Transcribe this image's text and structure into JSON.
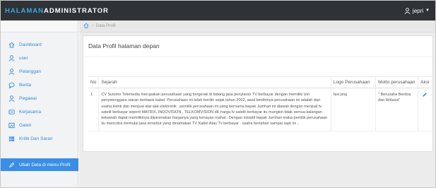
{
  "header": {
    "brand_part1": "HALAMAN",
    "brand_part2": "ADMINISTRATOR",
    "user_name": "jepri",
    "user_icon": "user-icon",
    "caret_icon": "caret-down-icon"
  },
  "breadcrumb": {
    "home_icon": "home-icon",
    "current": "Data Profil"
  },
  "sidebar": {
    "items": [
      {
        "label": "Dashboard",
        "icon": "home-icon"
      },
      {
        "label": "user",
        "icon": "user-icon"
      },
      {
        "label": "Pelanggan",
        "icon": "user-icon"
      },
      {
        "label": "Berita",
        "icon": "comment-icon"
      },
      {
        "label": "Pegawai",
        "icon": "user-icon"
      },
      {
        "label": "Kerjasama",
        "icon": "handshake-icon"
      },
      {
        "label": "Galeri",
        "icon": "image-icon"
      },
      {
        "label": "Kritik Dan Saran",
        "icon": "table-icon"
      }
    ],
    "active_item": {
      "label": "Ubah Data di menu Profil",
      "icon": "pencil-icon"
    }
  },
  "panel": {
    "title": "Data Profil halaman depan"
  },
  "table": {
    "headers": [
      "No",
      "Sejarah",
      "Logo Perusahaan",
      "Motto perusahaan",
      "Aksi"
    ],
    "rows": [
      {
        "no": "1",
        "sejarah": "CV Sutomo Telemedia merupakan perusahaan yang bergerak di bidang jasa penyiaran TV berbayar dengan memiliki izin penyelenggara siaran berbasis kabel. Perusahaan ini telah berdiri sejak tahun 2002, awal berdirinya perusahaan ini adalah dari usaha listrik dan menjual alat alat elektronik . pemilik perusahaan ini yang bernama bapak Jumhari ini diawali dengan menjual tv satelit berbayar seperti MATRIX, INDOVISION , TELKOMVISION dll. harga tv satelit berbayar itu mungkin tidak semua kalangan kebawah dapat memilikinya dikarenakan harganya yang lumayan mahal . Dengan inisiatif bapak Jumhari maka pemilik perusahaan itu mencoba memulai jasa tersebut yang dinamakan TV Kabel Atau Tv berbayar . usaha bertahan sampai saat ini ..",
        "logo": "favi.png",
        "motto": "\" Berusaha Berdoa dan Ikhlassi\"",
        "action_icon": "pencil-icon"
      }
    ]
  },
  "colors": {
    "topbar": "#2f3338",
    "accent": "#3aa6e0",
    "active": "#3a8ee6",
    "link": "#2f8ad8"
  }
}
